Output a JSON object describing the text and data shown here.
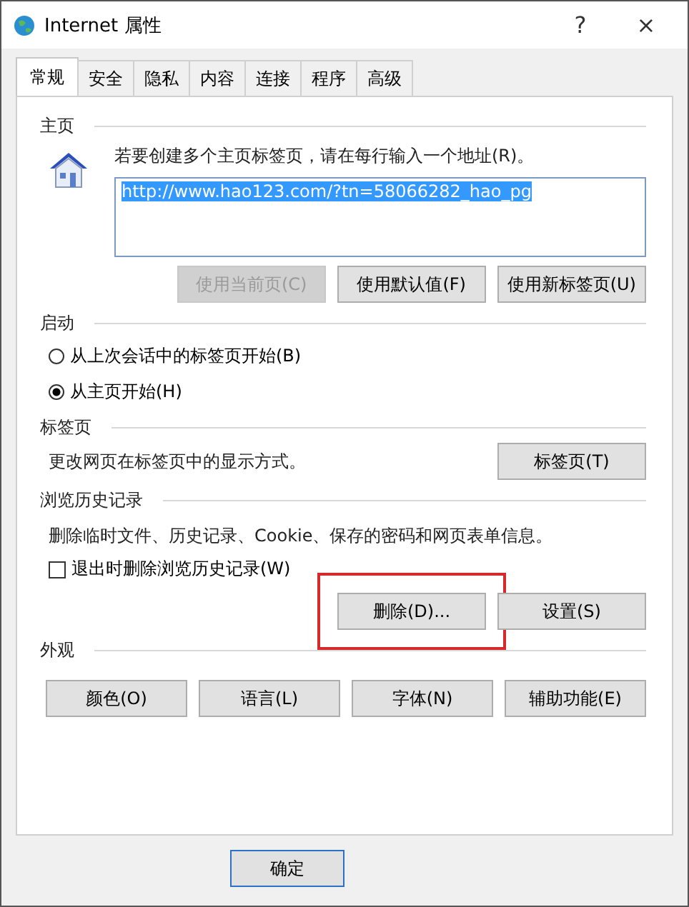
{
  "window": {
    "title": "Internet 属性",
    "help": "?",
    "close": "×"
  },
  "tabs": [
    {
      "label": "常规",
      "selected": true
    },
    {
      "label": "安全",
      "selected": false
    },
    {
      "label": "隐私",
      "selected": false
    },
    {
      "label": "内容",
      "selected": false
    },
    {
      "label": "连接",
      "selected": false
    },
    {
      "label": "程序",
      "selected": false
    },
    {
      "label": "高级",
      "selected": false
    }
  ],
  "home": {
    "heading": "主页",
    "hint": "若要创建多个主页标签页，请在每行输入一个地址(R)。",
    "url": "http://www.hao123.com/?tn=58066282_hao_pg",
    "buttons": [
      {
        "label": "使用当前页(C)",
        "disabled": true
      },
      {
        "label": "使用默认值(F)",
        "disabled": false
      },
      {
        "label": "使用新标签页(U)",
        "disabled": false
      }
    ]
  },
  "startup": {
    "heading": "启动",
    "options": [
      {
        "label": "从上次会话中的标签页开始(B)",
        "selected": false
      },
      {
        "label": "从主页开始(H)",
        "selected": true
      }
    ]
  },
  "tabs_section": {
    "heading": "标签页",
    "text": "更改网页在标签页中的显示方式。",
    "button": "标签页(T)"
  },
  "history": {
    "heading": "浏览历史记录",
    "text": "删除临时文件、历史记录、Cookie、保存的密码和网页表单信息。",
    "checkbox": {
      "label": "退出时删除浏览历史记录(W)",
      "checked": false
    },
    "buttons": [
      {
        "label": "删除(D)...",
        "highlighted": true
      },
      {
        "label": "设置(S)",
        "highlighted": false
      }
    ]
  },
  "appearance": {
    "heading": "外观",
    "buttons": [
      "颜色(O)",
      "语言(L)",
      "字体(N)",
      "辅助功能(E)"
    ]
  },
  "footer": {
    "buttons": [
      "确定"
    ]
  }
}
